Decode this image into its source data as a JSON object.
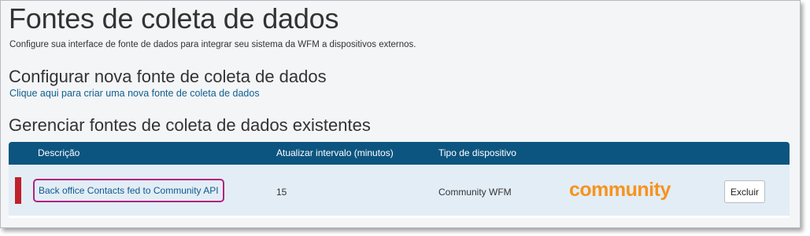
{
  "page": {
    "title": "Fontes de coleta de dados",
    "subtitle": "Configure sua interface de fonte de dados para integrar seu sistema da WFM a dispositivos externos."
  },
  "configure": {
    "heading": "Configurar nova fonte de coleta de dados",
    "create_link": "Clique aqui para criar uma nova fonte de coleta de dados"
  },
  "manage": {
    "heading": "Gerenciar fontes de coleta de dados existentes",
    "columns": {
      "description": "Descrição",
      "interval": "Atualizar intervalo (minutos)",
      "device_type": "Tipo de dispositivo"
    },
    "rows": [
      {
        "description": "Back office Contacts fed to Community API",
        "interval": "15",
        "device_type": "Community WFM",
        "logo_text": "community",
        "delete_label": "Excluir",
        "status_color": "#c0202a"
      }
    ]
  },
  "colors": {
    "header_bg": "#0c5580",
    "link": "#106090",
    "logo": "#f7931e",
    "highlight_border": "#b02480"
  }
}
